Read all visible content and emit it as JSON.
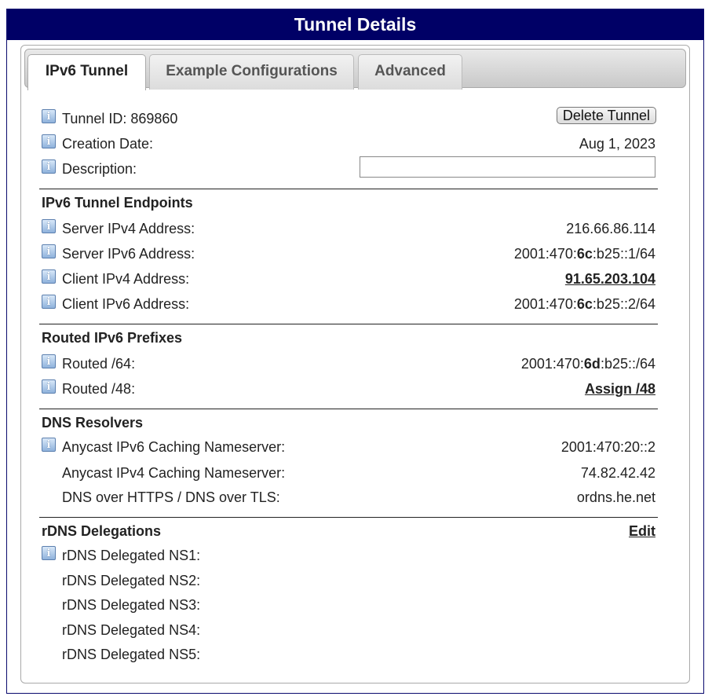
{
  "window": {
    "title": "Tunnel Details"
  },
  "tabs": [
    {
      "label": "IPv6 Tunnel",
      "active": true
    },
    {
      "label": "Example Configurations",
      "active": false
    },
    {
      "label": "Advanced",
      "active": false
    }
  ],
  "general": {
    "tunnel_id_label": "Tunnel ID: 869860",
    "delete_button": "Delete Tunnel",
    "creation_date_label": "Creation Date:",
    "creation_date_value": "Aug 1, 2023",
    "description_label": "Description:",
    "description_value": ""
  },
  "endpoints": {
    "title": "IPv6 Tunnel Endpoints",
    "server_ipv4_label": "Server IPv4 Address:",
    "server_ipv4_value": "216.66.86.114",
    "server_ipv6_label": "Server IPv6 Address:",
    "server_ipv6_pre": "2001:470:",
    "server_ipv6_bold": "6c",
    "server_ipv6_post": ":b25::1/64",
    "client_ipv4_label": "Client IPv4 Address:",
    "client_ipv4_value": "91.65.203.104",
    "client_ipv6_label": "Client IPv6 Address:",
    "client_ipv6_pre": "2001:470:",
    "client_ipv6_bold": "6c",
    "client_ipv6_post": ":b25::2/64"
  },
  "prefixes": {
    "title": "Routed IPv6 Prefixes",
    "routed64_label": "Routed /64:",
    "routed64_pre": "2001:470:",
    "routed64_bold": "6d",
    "routed64_post": ":b25::/64",
    "routed48_label": "Routed /48:",
    "routed48_link": "Assign /48"
  },
  "dns": {
    "title": "DNS Resolvers",
    "anycast_v6_label": "Anycast IPv6 Caching Nameserver:",
    "anycast_v6_value": "2001:470:20::2",
    "anycast_v4_label": "Anycast IPv4 Caching Nameserver:",
    "anycast_v4_value": "74.82.42.42",
    "doh_label": "DNS over HTTPS / DNS over TLS:",
    "doh_value": "ordns.he.net"
  },
  "rdns": {
    "title": "rDNS Delegations",
    "edit_link": "Edit",
    "ns1_label": "rDNS Delegated NS1:",
    "ns2_label": "rDNS Delegated NS2:",
    "ns3_label": "rDNS Delegated NS3:",
    "ns4_label": "rDNS Delegated NS4:",
    "ns5_label": "rDNS Delegated NS5:"
  },
  "icons": {
    "info": "info-icon"
  },
  "colors": {
    "title_bar": "#000066",
    "info_icon": "#8fb2dc"
  }
}
